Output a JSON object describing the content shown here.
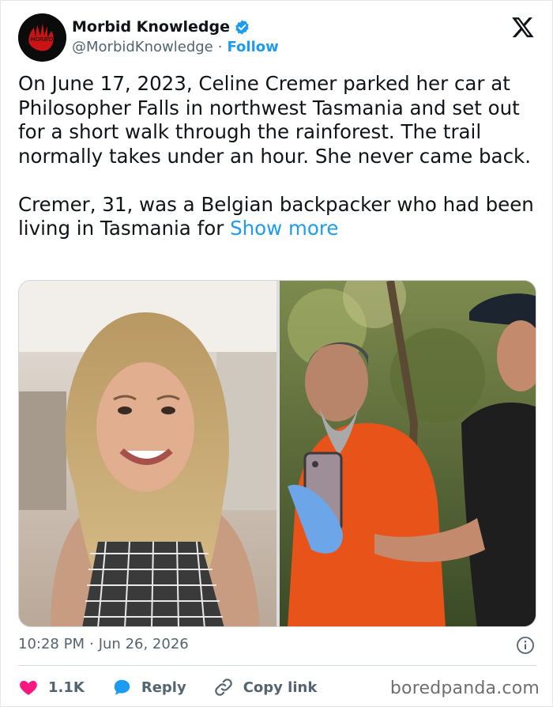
{
  "author": {
    "name": "Morbid Knowledge",
    "handle": "@MorbidKnowledge",
    "separator": "·",
    "follow_label": "Follow",
    "avatar_text": "MORBID"
  },
  "tweet": {
    "text": "On June 17, 2023, Celine Cremer parked her car at Philosopher Falls in northwest Tasmania and set out for a short walk through the rainforest. The trail normally takes under an hour. She never came back.\n\nCremer, 31, was a Belgian backpacker who had been living in Tasmania for ",
    "show_more": "Show more"
  },
  "meta": {
    "time": "10:28 PM",
    "separator": "·",
    "date": "Jun 26, 2026"
  },
  "actions": {
    "likes": "1.1K",
    "reply_label": "Reply",
    "copy_label": "Copy link"
  },
  "watermark": "boredpanda.com",
  "colors": {
    "accent": "#1d9bf0",
    "like": "#f91880",
    "muted": "#536471",
    "text": "#0f1419"
  }
}
